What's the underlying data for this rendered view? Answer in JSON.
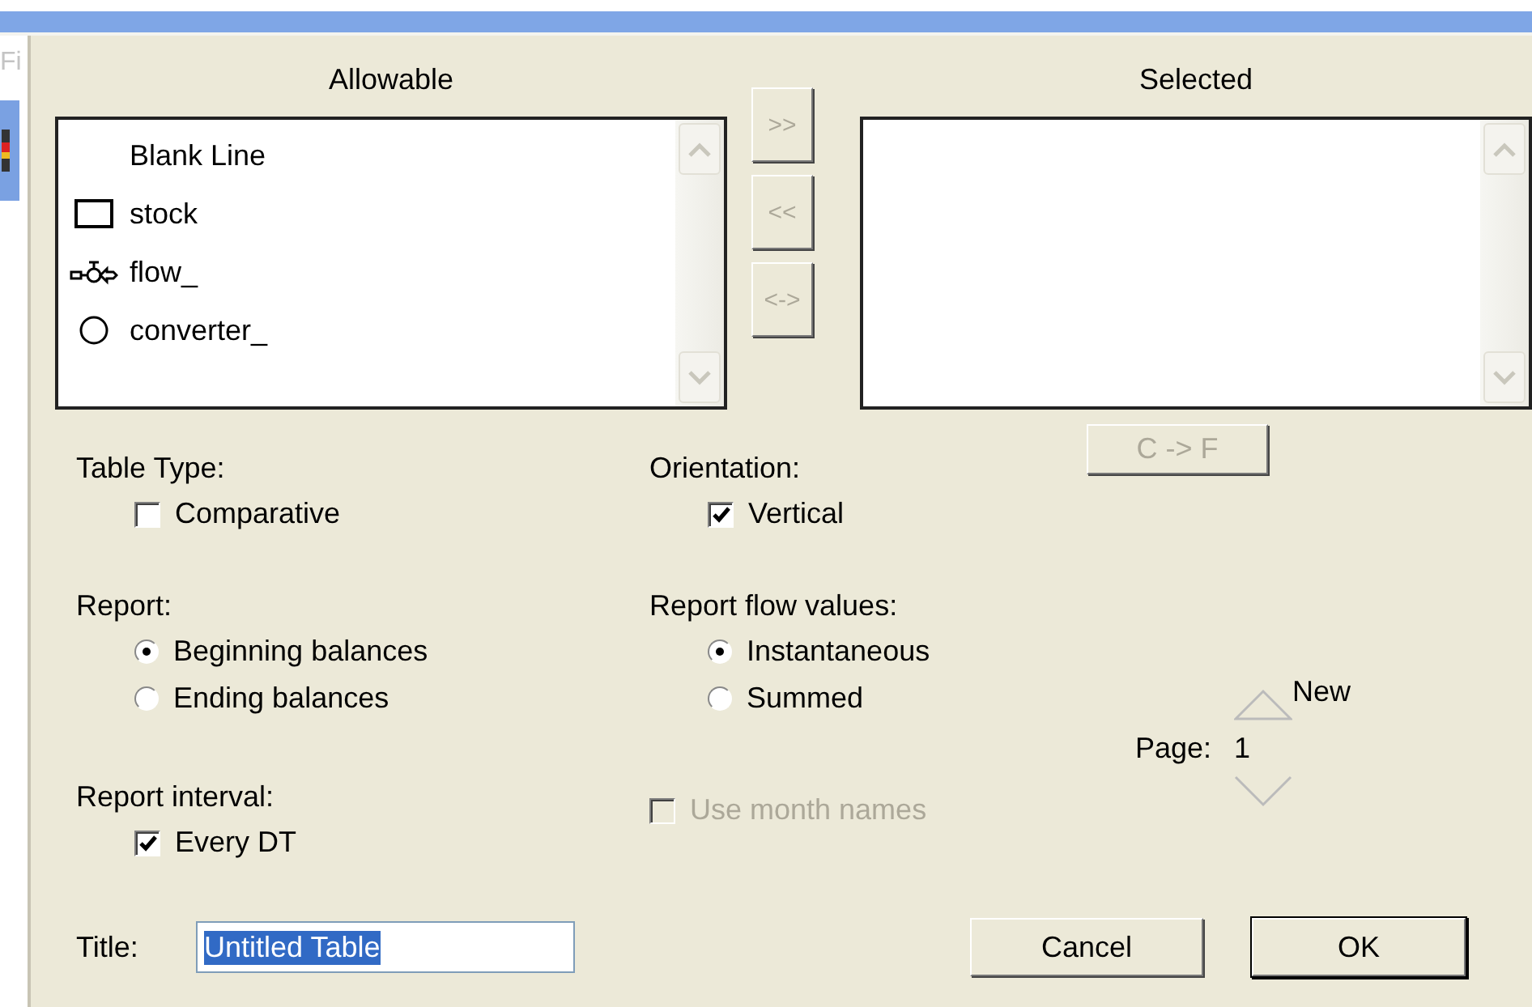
{
  "background": {
    "menu_fragment": "Fi"
  },
  "allowable": {
    "label": "Allowable",
    "items": [
      {
        "kind": "blank",
        "label": "Blank Line"
      },
      {
        "kind": "stock",
        "label": "stock"
      },
      {
        "kind": "flow",
        "label": "flow_"
      },
      {
        "kind": "converter",
        "label": "converter_"
      }
    ]
  },
  "transfer_buttons": [
    {
      "label": ">>",
      "disabled": true
    },
    {
      "label": "<<",
      "disabled": true
    },
    {
      "label": "<->",
      "disabled": true
    }
  ],
  "selected": {
    "label": "Selected"
  },
  "convert_button": {
    "label": "C -> F",
    "disabled": true
  },
  "table_type": {
    "label": "Table Type:",
    "options": [
      {
        "label": "Comparative",
        "checked": false
      }
    ]
  },
  "orientation": {
    "label": "Orientation:",
    "options": [
      {
        "label": "Vertical",
        "checked": true
      }
    ]
  },
  "report": {
    "label": "Report:",
    "options": [
      {
        "label": "Beginning balances",
        "selected": true
      },
      {
        "label": "Ending balances",
        "selected": false
      }
    ]
  },
  "report_flow_values": {
    "label": "Report flow values:",
    "options": [
      {
        "label": "Instantaneous",
        "selected": true
      },
      {
        "label": "Summed",
        "selected": false
      }
    ]
  },
  "report_interval": {
    "label": "Report interval:",
    "options": [
      {
        "label": "Every DT",
        "checked": true
      }
    ]
  },
  "use_month_names": {
    "label": "Use month names",
    "checked": false,
    "disabled": true
  },
  "page": {
    "label": "Page:",
    "value": "1",
    "new_label": "New"
  },
  "title": {
    "label": "Title:",
    "value": "Untitled Table",
    "text_selected": true
  },
  "buttons": [
    {
      "label": "Cancel",
      "default": false
    },
    {
      "label": "OK",
      "default": true
    }
  ]
}
